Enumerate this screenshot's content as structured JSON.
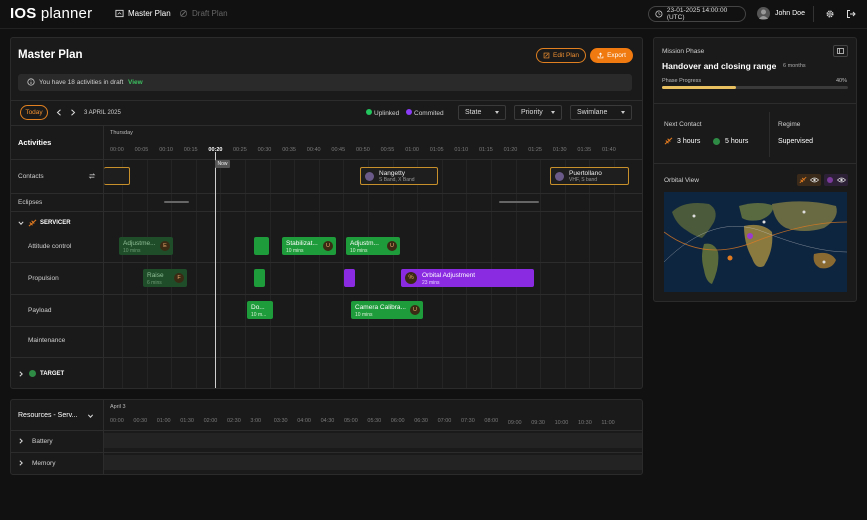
{
  "app": {
    "logo_bold": "IOS",
    "logo_rest": " planner"
  },
  "nav": [
    {
      "label": "Master Plan",
      "active": true,
      "icon": "calendar-icon"
    },
    {
      "label": "Draft Plan",
      "active": false,
      "icon": "draft-icon"
    }
  ],
  "header": {
    "datetime": "23-01-2025 14:00:00 (UTC)",
    "user": "John Doe"
  },
  "master": {
    "title": "Master Plan",
    "edit_label": "Edit Plan",
    "export_label": "Export",
    "draft_notice": "You have 18 activities in draft",
    "draft_link": "View",
    "today_label": "Today",
    "date": "3 APRIL 2025",
    "legend": [
      {
        "label": "Uplinked",
        "color": "#22c55e"
      },
      {
        "label": "Commited",
        "color": "#8b3cf7"
      }
    ],
    "filters": [
      "State",
      "Priority",
      "Swimlane"
    ],
    "activities_label": "Activities",
    "day_label": "Thursday",
    "now_label": "Now",
    "ticks": [
      "00:00",
      "00:05",
      "00:10",
      "00:15",
      "00:20",
      "00:25",
      "00:30",
      "00:35",
      "00:40",
      "00:45",
      "00:50",
      "00:55",
      "01:00",
      "01:05",
      "01:10",
      "01:15",
      "01:20",
      "01:25",
      "01:30",
      "01:35",
      "01:40"
    ],
    "rows": {
      "contacts": "Contacts",
      "eclipses": "Eclipses",
      "servicer": "SERVICER",
      "attitude": "Attitude control",
      "propulsion": "Propulsion",
      "payload": "Payload",
      "maintenance": "Maintenance",
      "target": "TARGET"
    },
    "contacts": [
      {
        "name": "Nangetty",
        "band": "S Band, X Band"
      },
      {
        "name": "Puertollano",
        "band": "VHF, S band"
      }
    ],
    "activities": {
      "att1": {
        "title": "Adjustme...",
        "dur": "10 mins",
        "badge": "E"
      },
      "att2": {
        "title": "Stabilizat...",
        "dur": "10 mins",
        "badge": "U"
      },
      "att3": {
        "title": "Adjustm...",
        "dur": "10 mins",
        "badge": "U"
      },
      "prop1": {
        "title": "Raise",
        "dur": "6 mins",
        "badge": "F"
      },
      "prop2": {
        "title": "Orbital Adjustment",
        "dur": "23 mins"
      },
      "pay1": {
        "title": "Do...",
        "dur": "10 m..."
      },
      "pay2": {
        "title": "Camera Calibra...",
        "dur": "10 mins",
        "badge": "U"
      }
    }
  },
  "resources": {
    "title": "Resources - Serv...",
    "date": "April 3",
    "ticks": [
      "00:00",
      "00:30",
      "01:00",
      "01:30",
      "02:00",
      "02:30",
      "3:00",
      "03:30",
      "04:00",
      "04:30",
      "05:00",
      "05:30",
      "06:00",
      "06:30",
      "07:00",
      "07:30",
      "08:00",
      "09:00",
      "09:30",
      "10:00",
      "10:30",
      "11:00"
    ],
    "rows": [
      "Battery",
      "Memory"
    ]
  },
  "mission": {
    "label": "Mission Phase",
    "phase": "Handover and closing range",
    "duration": "6 months",
    "progress_label": "Phase Progress",
    "progress_text": "40%",
    "progress": 0.4
  },
  "contact_info": {
    "label": "Next Contact",
    "servicer_time": "3 hours",
    "target_time": "5 hours",
    "regime_label": "Regime",
    "regime": "Supervised"
  },
  "orbital": {
    "label": "Orbital View"
  }
}
